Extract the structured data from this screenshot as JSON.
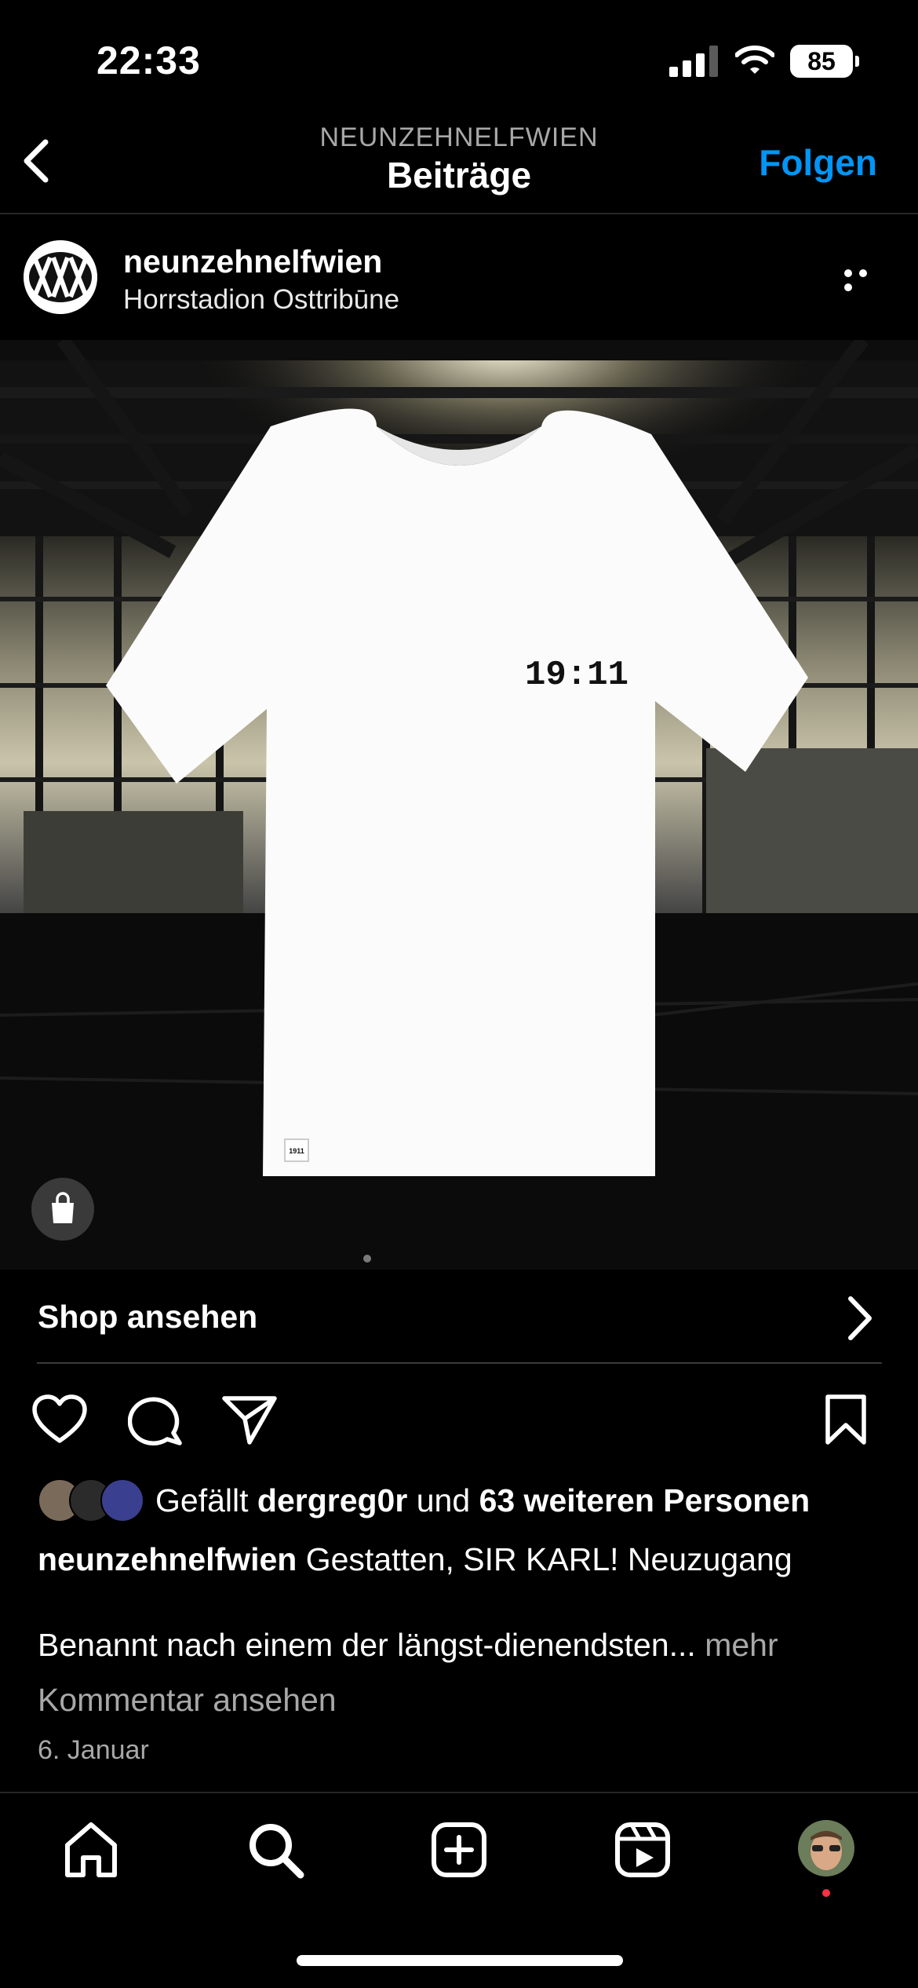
{
  "status_bar": {
    "time": "22:33",
    "battery": "85"
  },
  "header": {
    "account": "NEUNZEHNELFWIEN",
    "title": "Beiträge",
    "follow_label": "Folgen"
  },
  "post": {
    "username": "neunzehnelfwien",
    "location": "Horrstadion Osttribūne",
    "image": {
      "shirt_print": "19:11",
      "label_text": "1911"
    },
    "shop_label": "Shop ansehen",
    "likes": {
      "prefix": "Gefällt",
      "user": "dergreg0r",
      "conj": "und",
      "others": "63 weiteren Personen"
    },
    "caption": {
      "username": "neunzehnelfwien",
      "text": "Gestatten, SIR KARL! Neuzugang",
      "continuation": "Benannt nach einem der längst-dienendsten...",
      "more": "mehr"
    },
    "view_comments": "Kommentar ansehen",
    "date": "6. Januar"
  },
  "colors": {
    "accent": "#0095f6",
    "background": "#000000",
    "secondary_text": "#a8a8a8",
    "notification": "#ff3040"
  },
  "icons": {
    "actions": [
      "heart-icon",
      "comment-icon",
      "share-icon",
      "bookmark-icon"
    ],
    "tabs": [
      "home-icon",
      "search-icon",
      "create-icon",
      "reels-icon",
      "profile-avatar"
    ]
  }
}
